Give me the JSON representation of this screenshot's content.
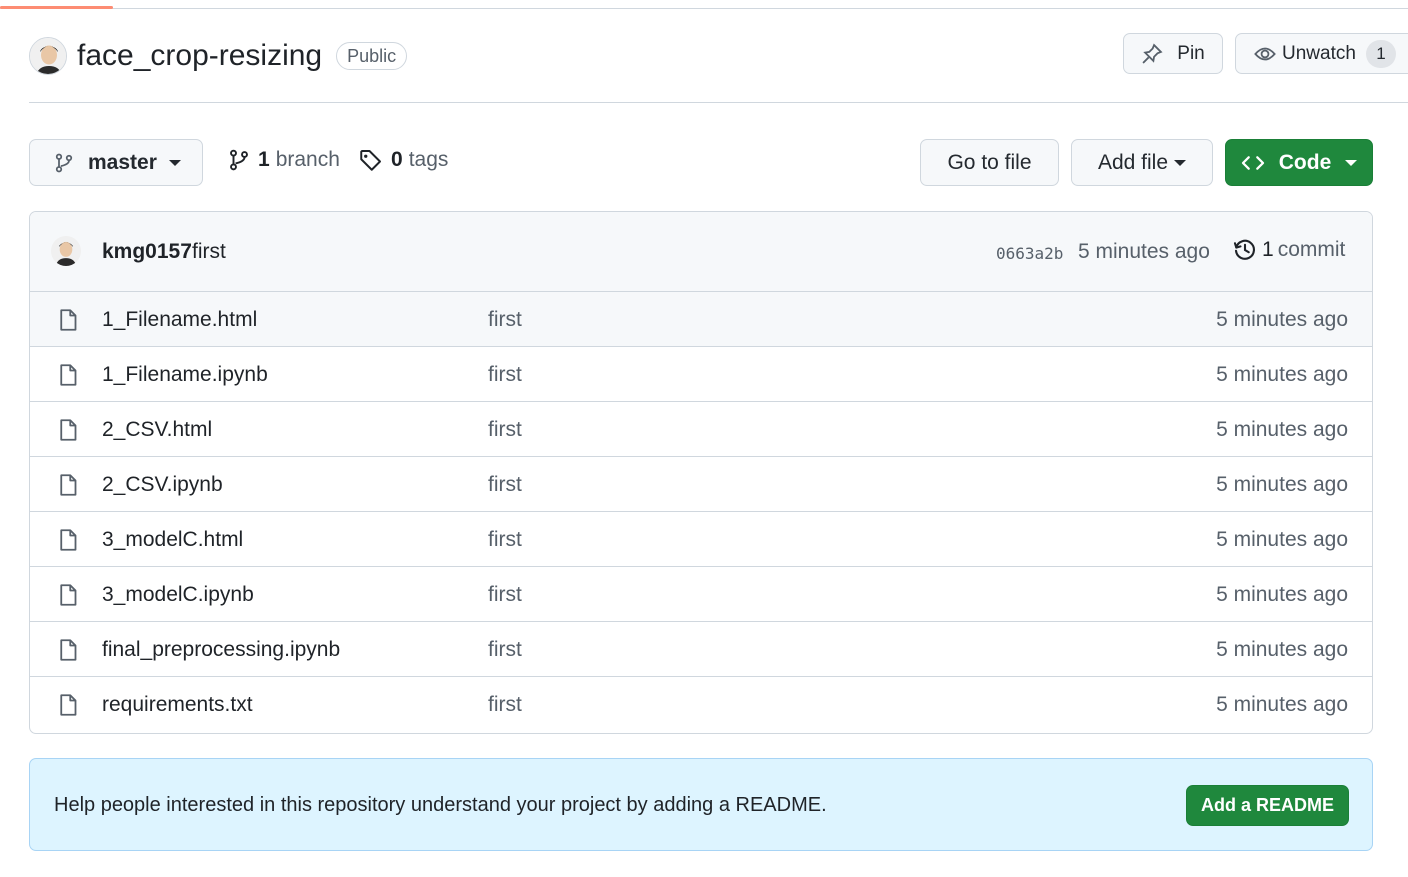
{
  "repo": {
    "name": "face_crop-resizing",
    "visibility": "Public"
  },
  "header_actions": {
    "pin_label": "Pin",
    "watch_label": "Unwatch",
    "watch_count": "1"
  },
  "toolbar": {
    "branch_name": "master",
    "branch_count": "1",
    "branch_label": "branch",
    "tag_count": "0",
    "tag_label": "tags",
    "go_to_file": "Go to file",
    "add_file": "Add file",
    "code": "Code"
  },
  "latest_commit": {
    "author": "kmg0157",
    "message": "first",
    "sha": "0663a2b",
    "time": "5 minutes ago",
    "commit_count": "1",
    "commit_label": "commit"
  },
  "files": [
    {
      "name": "1_Filename.html",
      "commit": "first",
      "time": "5 minutes ago"
    },
    {
      "name": "1_Filename.ipynb",
      "commit": "first",
      "time": "5 minutes ago"
    },
    {
      "name": "2_CSV.html",
      "commit": "first",
      "time": "5 minutes ago"
    },
    {
      "name": "2_CSV.ipynb",
      "commit": "first",
      "time": "5 minutes ago"
    },
    {
      "name": "3_modelC.html",
      "commit": "first",
      "time": "5 minutes ago"
    },
    {
      "name": "3_modelC.ipynb",
      "commit": "first",
      "time": "5 minutes ago"
    },
    {
      "name": "final_preprocessing.ipynb",
      "commit": "first",
      "time": "5 minutes ago"
    },
    {
      "name": "requirements.txt",
      "commit": "first",
      "time": "5 minutes ago"
    }
  ],
  "readme_banner": {
    "text": "Help people interested in this repository understand your project by adding a README.",
    "button": "Add a README"
  },
  "colors": {
    "primary_green": "#1f883d",
    "banner_blue": "#ddf4ff",
    "tab_accent": "#fd8c73"
  },
  "icons": [
    "avatar",
    "pin-icon",
    "eye-icon",
    "branch-icon",
    "tag-icon",
    "code-icon",
    "history-icon",
    "file-icon"
  ]
}
